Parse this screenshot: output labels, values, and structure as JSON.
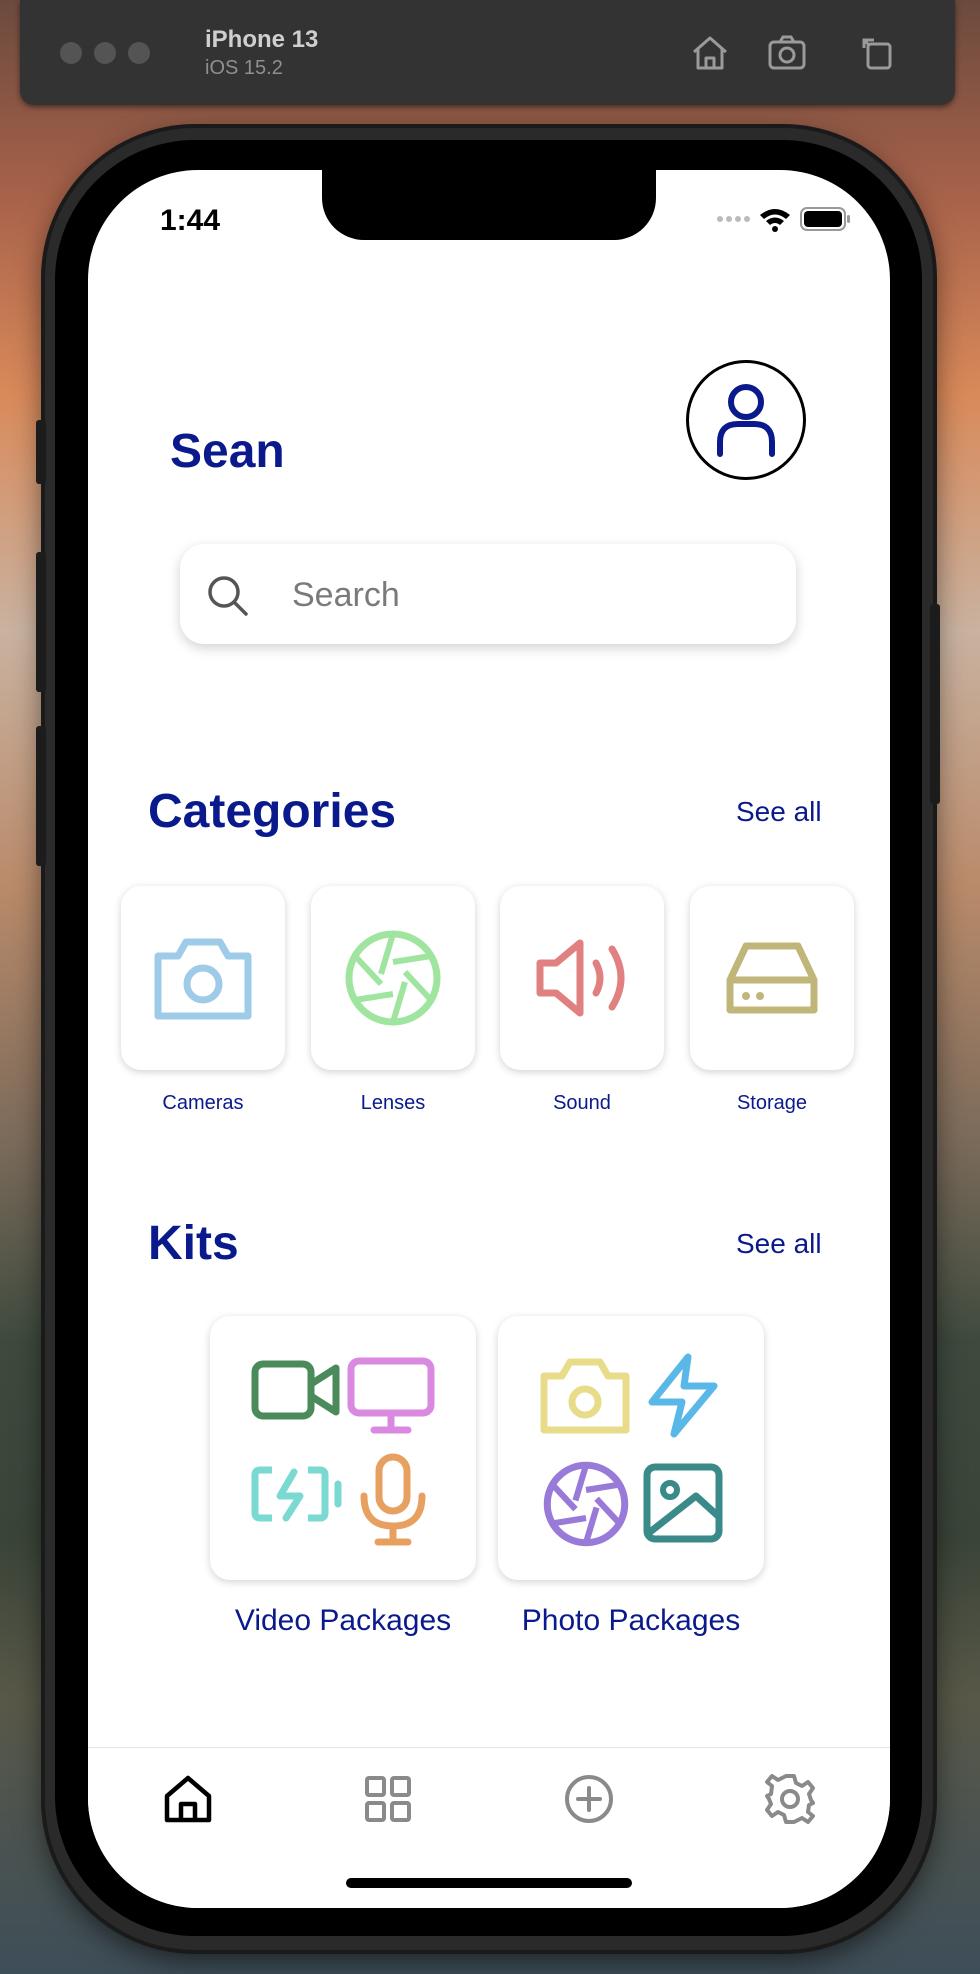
{
  "simulator": {
    "device": "iPhone 13",
    "os": "iOS 15.2",
    "icons": [
      "home-icon",
      "screenshot-icon",
      "rotate-icon"
    ]
  },
  "status_bar": {
    "time": "1:44"
  },
  "header": {
    "greeting": "Sean"
  },
  "search": {
    "placeholder": "Search"
  },
  "categories": {
    "title": "Categories",
    "see_all": "See all",
    "items": [
      {
        "label": "Cameras",
        "icon": "camera-icon",
        "color": "#9ecbe8"
      },
      {
        "label": "Lenses",
        "icon": "aperture-icon",
        "color": "#9fe59f"
      },
      {
        "label": "Sound",
        "icon": "speaker-icon",
        "color": "#e08080"
      },
      {
        "label": "Storage",
        "icon": "hard-drive-icon",
        "color": "#c1b67a"
      }
    ]
  },
  "kits": {
    "title": "Kits",
    "see_all": "See all",
    "items": [
      {
        "label": "Video Packages",
        "icons": [
          "video-camera-icon",
          "monitor-icon",
          "battery-charging-icon",
          "microphone-icon"
        ]
      },
      {
        "label": "Photo Packages",
        "icons": [
          "camera-icon",
          "flash-icon",
          "aperture-icon",
          "image-icon"
        ]
      }
    ]
  },
  "tabbar": {
    "items": [
      {
        "icon": "home-icon",
        "active": true
      },
      {
        "icon": "grid-icon",
        "active": false
      },
      {
        "icon": "plus-circle-icon",
        "active": false
      },
      {
        "icon": "gear-icon",
        "active": false
      }
    ]
  },
  "colors": {
    "brand": "#0a1a8c",
    "video": "#4b8a5a",
    "monitor": "#d98ae0",
    "battery": "#7ad9d0",
    "mic": "#e8a060",
    "photo_camera": "#e8dc8a",
    "flash": "#5ab8e8",
    "aperture": "#9a7ad9",
    "image": "#3a8a8a"
  }
}
